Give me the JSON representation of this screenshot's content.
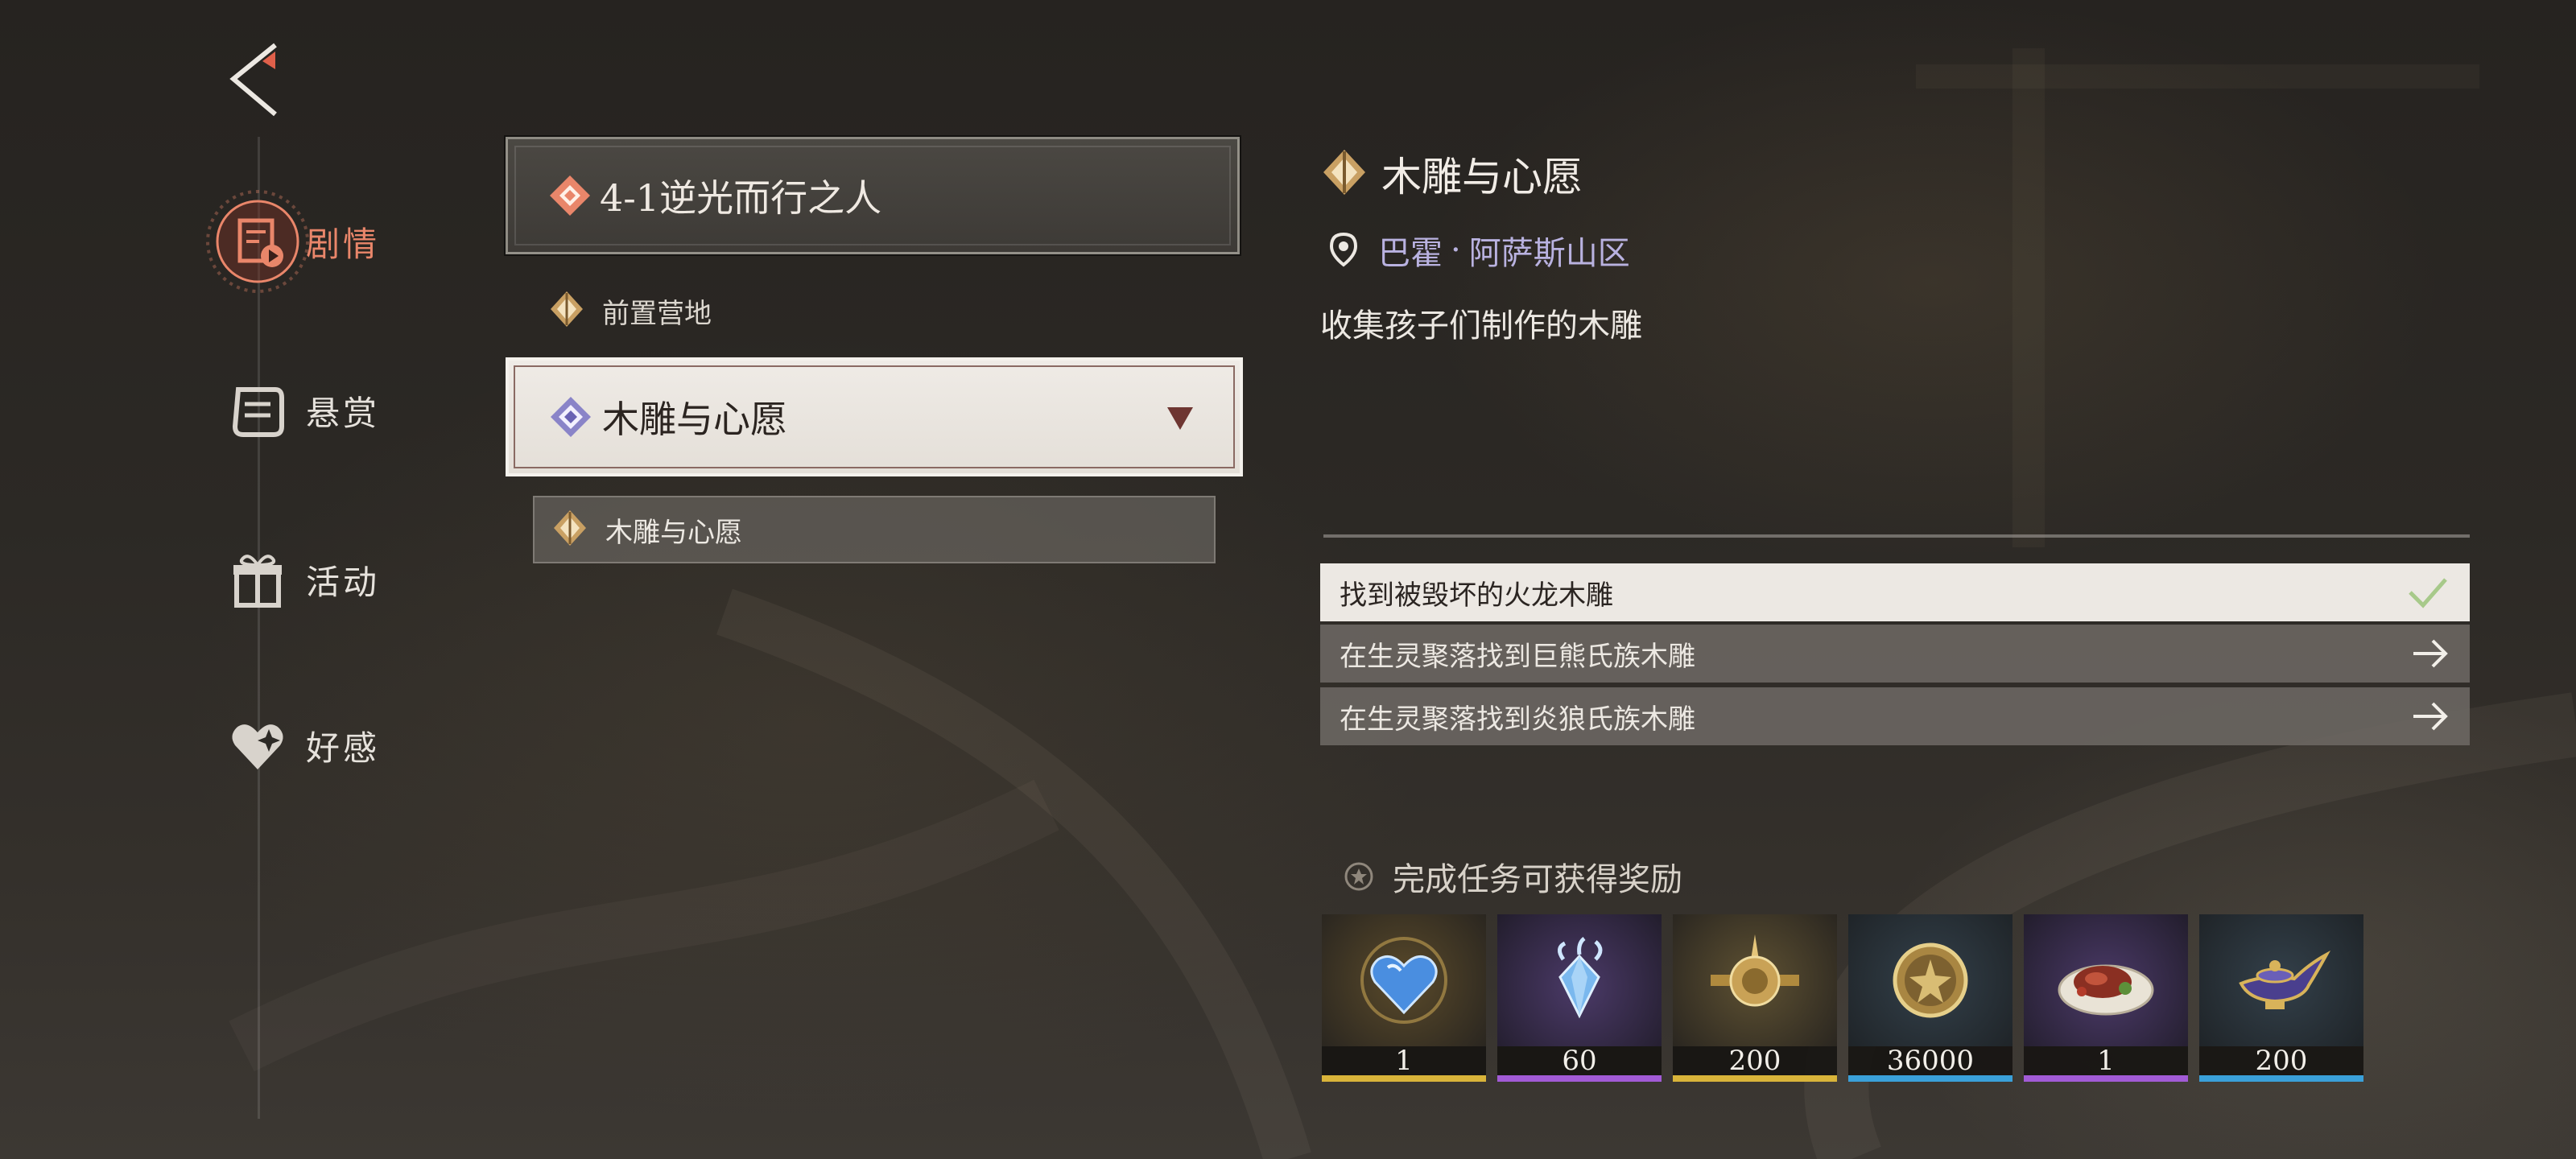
{
  "nav": {
    "items": [
      {
        "label": "剧情",
        "icon": "story-scroll-icon",
        "active": true
      },
      {
        "label": "悬赏",
        "icon": "bounty-scroll-icon",
        "active": false
      },
      {
        "label": "活动",
        "icon": "gift-box-icon",
        "active": false
      },
      {
        "label": "好感",
        "icon": "heart-sparkle-icon",
        "active": false
      }
    ]
  },
  "quest_list": {
    "chapter": {
      "label": "4-1逆光而行之人"
    },
    "camp": {
      "label": "前置营地"
    },
    "selected_quest": {
      "label": "木雕与心愿"
    },
    "selected_sub": {
      "label": "木雕与心愿"
    }
  },
  "detail": {
    "title": "木雕与心愿",
    "location_region": "巴霍",
    "location_sep": "·",
    "location_area": "阿萨斯山区",
    "description": "收集孩子们制作的木雕",
    "objectives": [
      {
        "label": "找到被毁坏的火龙木雕",
        "status": "done"
      },
      {
        "label": "在生灵聚落找到巨熊氏族木雕",
        "status": "todo"
      },
      {
        "label": "在生灵聚落找到炎狼氏族木雕",
        "status": "todo"
      }
    ],
    "rewards_header": "完成任务可获得奖励",
    "rewards": [
      {
        "count": "1",
        "icon": "blue-heart-gem-icon",
        "rarity_color": "#d9b43a"
      },
      {
        "count": "60",
        "icon": "crystal-shard-icon",
        "rarity_color": "#a25bd6"
      },
      {
        "count": "200",
        "icon": "golden-star-medal-icon",
        "rarity_color": "#d9b43a"
      },
      {
        "count": "36000",
        "icon": "gold-coin-icon",
        "rarity_color": "#3aa0d9"
      },
      {
        "count": "1",
        "icon": "roast-meat-plate-icon",
        "rarity_color": "#a25bd6"
      },
      {
        "count": "200",
        "icon": "magic-lamp-icon",
        "rarity_color": "#3aa0d9"
      }
    ]
  },
  "colors": {
    "accent_active": "#e9866a",
    "location_text": "#b9b2e0"
  }
}
